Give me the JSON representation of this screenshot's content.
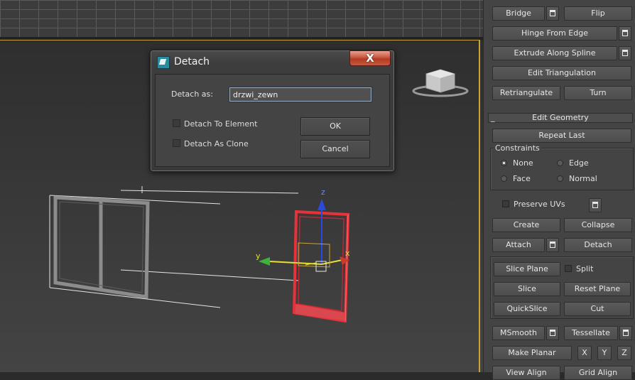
{
  "dialog": {
    "title": "Detach",
    "close_label": "X",
    "detach_as_label": "Detach as:",
    "detach_as_value": "drzwi_zewn",
    "detach_to_element_label": "Detach To Element",
    "detach_as_clone_label": "Detach As Clone",
    "ok_label": "OK",
    "cancel_label": "Cancel"
  },
  "viewport": {
    "axis_x": "x",
    "axis_y": "y",
    "axis_z": "z"
  },
  "panel": {
    "top_buttons": {
      "bridge": "Bridge",
      "flip": "Flip",
      "hinge_from_edge": "Hinge From Edge",
      "extrude_along_spline": "Extrude Along Spline",
      "edit_triangulation": "Edit Triangulation",
      "retriangulate": "Retriangulate",
      "turn": "Turn"
    },
    "edit_geometry": {
      "collapse_symbol": "_",
      "title": "Edit Geometry",
      "repeat_last": "Repeat Last",
      "constraints_title": "Constraints",
      "constraints": [
        "None",
        "Edge",
        "Face",
        "Normal"
      ],
      "constraint_selected": "None",
      "preserve_uvs": "Preserve UVs",
      "create": "Create",
      "collapse": "Collapse",
      "attach": "Attach",
      "detach": "Detach",
      "slice_plane": "Slice Plane",
      "split": "Split",
      "slice": "Slice",
      "reset_plane": "Reset Plane",
      "quickslice": "QuickSlice",
      "cut": "Cut",
      "msmooth": "MSmooth",
      "tessellate": "Tessellate",
      "make_planar": "Make Planar",
      "x": "X",
      "y": "Y",
      "z": "Z",
      "view_align": "View Align",
      "grid_align": "Grid Align"
    }
  },
  "colors": {
    "selection": "#e8323a",
    "viewport_border": "#c8a43a",
    "axis_x": "#c83c2a",
    "axis_y": "#3cb43c",
    "axis_z": "#2a4adc"
  }
}
